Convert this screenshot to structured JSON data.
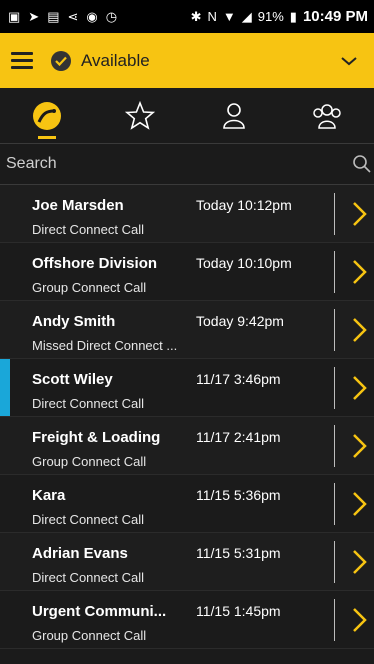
{
  "status_bar": {
    "icons": [
      "messages-icon",
      "forward-icon",
      "fc-icon",
      "share-icon",
      "circle-icon",
      "alarm-icon"
    ],
    "right_icons": [
      "bluetooth-icon",
      "nfc-icon",
      "wifi-icon",
      "signal-icon"
    ],
    "battery": "91%",
    "time": "10:49 PM"
  },
  "app_bar": {
    "status_label": "Available",
    "accent_color": "#f7c412"
  },
  "tabs": [
    {
      "icon": "recent-calls-icon",
      "active": true
    },
    {
      "icon": "star-icon",
      "active": false
    },
    {
      "icon": "contact-icon",
      "active": false
    },
    {
      "icon": "group-icon",
      "active": false
    }
  ],
  "search": {
    "placeholder": "Search"
  },
  "calls": [
    {
      "name": "Joe Marsden",
      "time": "Today 10:12pm",
      "type": "Direct Connect Call",
      "marked": false
    },
    {
      "name": "Offshore Division",
      "time": "Today 10:10pm",
      "type": "Group Connect Call",
      "marked": false
    },
    {
      "name": "Andy Smith",
      "time": "Today 9:42pm",
      "type": "Missed Direct Connect ...",
      "marked": false
    },
    {
      "name": "Scott Wiley",
      "time": "11/17 3:46pm",
      "type": "Direct Connect Call",
      "marked": true
    },
    {
      "name": "Freight & Loading",
      "time": "11/17 2:41pm",
      "type": "Group Connect Call",
      "marked": false
    },
    {
      "name": "Kara",
      "time": "11/15 5:36pm",
      "type": "Direct Connect Call",
      "marked": false
    },
    {
      "name": "Adrian Evans",
      "time": "11/15 5:31pm",
      "type": "Direct Connect Call",
      "marked": false
    },
    {
      "name": "Urgent Communi...",
      "time": "11/15 1:45pm",
      "type": "Group Connect Call",
      "marked": false
    }
  ]
}
